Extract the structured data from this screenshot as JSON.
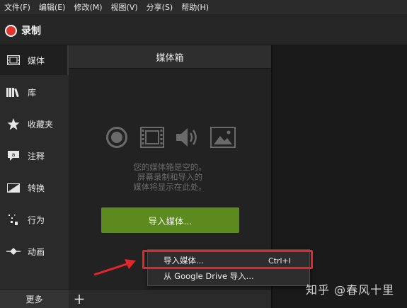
{
  "menubar": {
    "items": [
      "文件(F)",
      "编辑(E)",
      "修改(M)",
      "视图(V)",
      "分享(S)",
      "帮助(H)"
    ]
  },
  "record": {
    "label": "录制",
    "color": "#e0342f"
  },
  "leftnav": {
    "items": [
      {
        "label": "媒体",
        "icon": "film-icon",
        "active": true
      },
      {
        "label": "库",
        "icon": "library-icon",
        "active": false
      },
      {
        "label": "收藏夹",
        "icon": "star-icon",
        "active": false
      },
      {
        "label": "注释",
        "icon": "annotation-icon",
        "active": false
      },
      {
        "label": "转换",
        "icon": "transition-icon",
        "active": false
      },
      {
        "label": "行为",
        "icon": "behavior-icon",
        "active": false
      },
      {
        "label": "动画",
        "icon": "animation-icon",
        "active": false
      }
    ],
    "more_label": "更多"
  },
  "media": {
    "title": "媒体箱",
    "empty_lines": [
      "您的媒体箱是空的。",
      "屏幕录制和导入的",
      "媒体将显示在此处。"
    ],
    "import_button": "导入媒体...",
    "add_label": "+",
    "accent": "#5c8a1e",
    "icons": [
      "record-icon",
      "film-icon",
      "audio-icon",
      "image-icon"
    ]
  },
  "context_menu": {
    "items": [
      {
        "label": "导入媒体...",
        "shortcut": "Ctrl+I"
      },
      {
        "label": "从 Google Drive 导入...",
        "shortcut": ""
      }
    ],
    "highlight_color": "#e3262b"
  },
  "watermark": "知乎 @春风十里"
}
